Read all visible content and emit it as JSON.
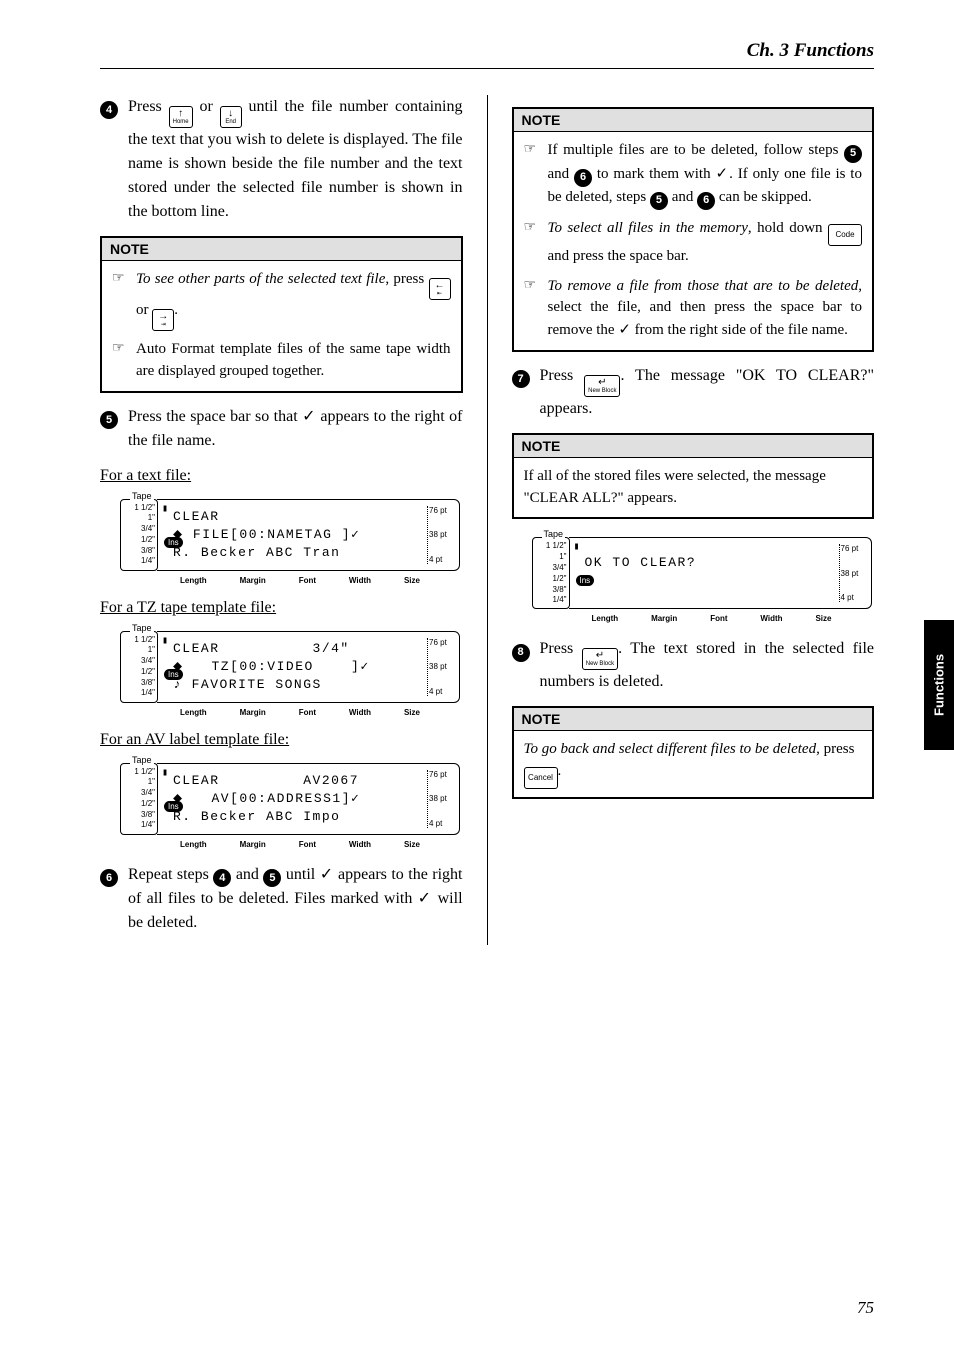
{
  "chapter": "Ch. 3 Functions",
  "sideTab": "Functions",
  "pageNumber": "75",
  "keys": {
    "home": {
      "arrow": "↑",
      "label": "Home"
    },
    "end": {
      "arrow": "↓",
      "label": "End"
    },
    "left": {
      "arrow": "←",
      "label": "⇤"
    },
    "right": {
      "arrow": "→",
      "label": "⇥"
    },
    "code": "Code",
    "newBlock": {
      "arrow": "↵",
      "label": "New Block"
    },
    "cancel": "Cancel"
  },
  "left": {
    "step4": {
      "pre": "Press ",
      "mid": " or ",
      "post": " until the file number containing the text that you wish to delete is displayed. The file name is shown beside the file number and the text stored under the selected file number is shown in the bottom line."
    },
    "note1": {
      "title": "NOTE",
      "item1_pre": "To see other parts of the selected text file",
      "item1_mid": ", press ",
      "item1_or": " or ",
      "item1_end": ".",
      "item2": "Auto Format template files of the same tape width are displayed grouped together."
    },
    "step5": {
      "pre": "Press the space bar so that ",
      "post": " appears to the right of the file name."
    },
    "subTextFile": "For a text file:",
    "subTzFile": "For a TZ tape template file:",
    "subAvFile": "For an AV label template file:",
    "step6": {
      "pre": "Repeat steps ",
      "mid1": " and ",
      "mid2": " until ",
      "post": " appears to the right of all files to be deleted. Files marked with ",
      "end": " will be deleted."
    }
  },
  "right": {
    "note2": {
      "title": "NOTE",
      "item1_pre": "If multiple files are to be deleted, follow steps ",
      "item1_mid1": " and ",
      "item1_mid2": " to mark them with ",
      "item1_mid3": ". If only one file is to be deleted, steps ",
      "item1_mid4": " and ",
      "item1_end": " can be skipped.",
      "item2_pre": "To select all files in the memory",
      "item2_mid": ", hold down ",
      "item2_end": " and press the space bar.",
      "item3_pre": "To remove a file from those that are to be deleted",
      "item3_mid": ", select the file, and then press the space bar to remove the ",
      "item3_end": " from the right side of the file name."
    },
    "step7": {
      "pre": "Press ",
      "post": ". The message \"OK TO CLEAR?\" appears."
    },
    "note3": {
      "title": "NOTE",
      "body": "If all of the stored files were selected, the message \"CLEAR ALL?\" appears."
    },
    "step8": {
      "pre": "Press ",
      "post": ". The text stored in the selected file numbers is deleted."
    },
    "note4": {
      "title": "NOTE",
      "body_pre": "To go back and select different files to be deleted",
      "body_mid": ", press ",
      "body_end": "."
    }
  },
  "lcd": {
    "tapeLabel": "Tape",
    "tapeSizes": [
      "1 1/2\"",
      "1\"",
      "3/4\"",
      "1/2\"",
      "3/8\"",
      "1/4\""
    ],
    "rightPts": [
      "76 pt",
      "38 pt",
      "4 pt"
    ],
    "bottomLabels": [
      "Length",
      "Margin",
      "Font",
      "Width",
      "Size"
    ],
    "ins": "Ins",
    "screen1": {
      "l1": "CLEAR",
      "l2": "⬥ FILE[00:NAMETAG ]✓",
      "l3": "R. Becker ABC Tran"
    },
    "screen2": {
      "l1": "CLEAR          3/4\"",
      "l2": "⬥   TZ[00:VIDEO    ]✓",
      "l3": "♪ FAVORITE SONGS"
    },
    "screen3": {
      "l1": "CLEAR         AV2067",
      "l2": "⬥   AV[00:ADDRESS1]✓",
      "l3": "R. Becker ABC Impo"
    },
    "screen4": {
      "l1": "OK TO CLEAR?"
    }
  }
}
